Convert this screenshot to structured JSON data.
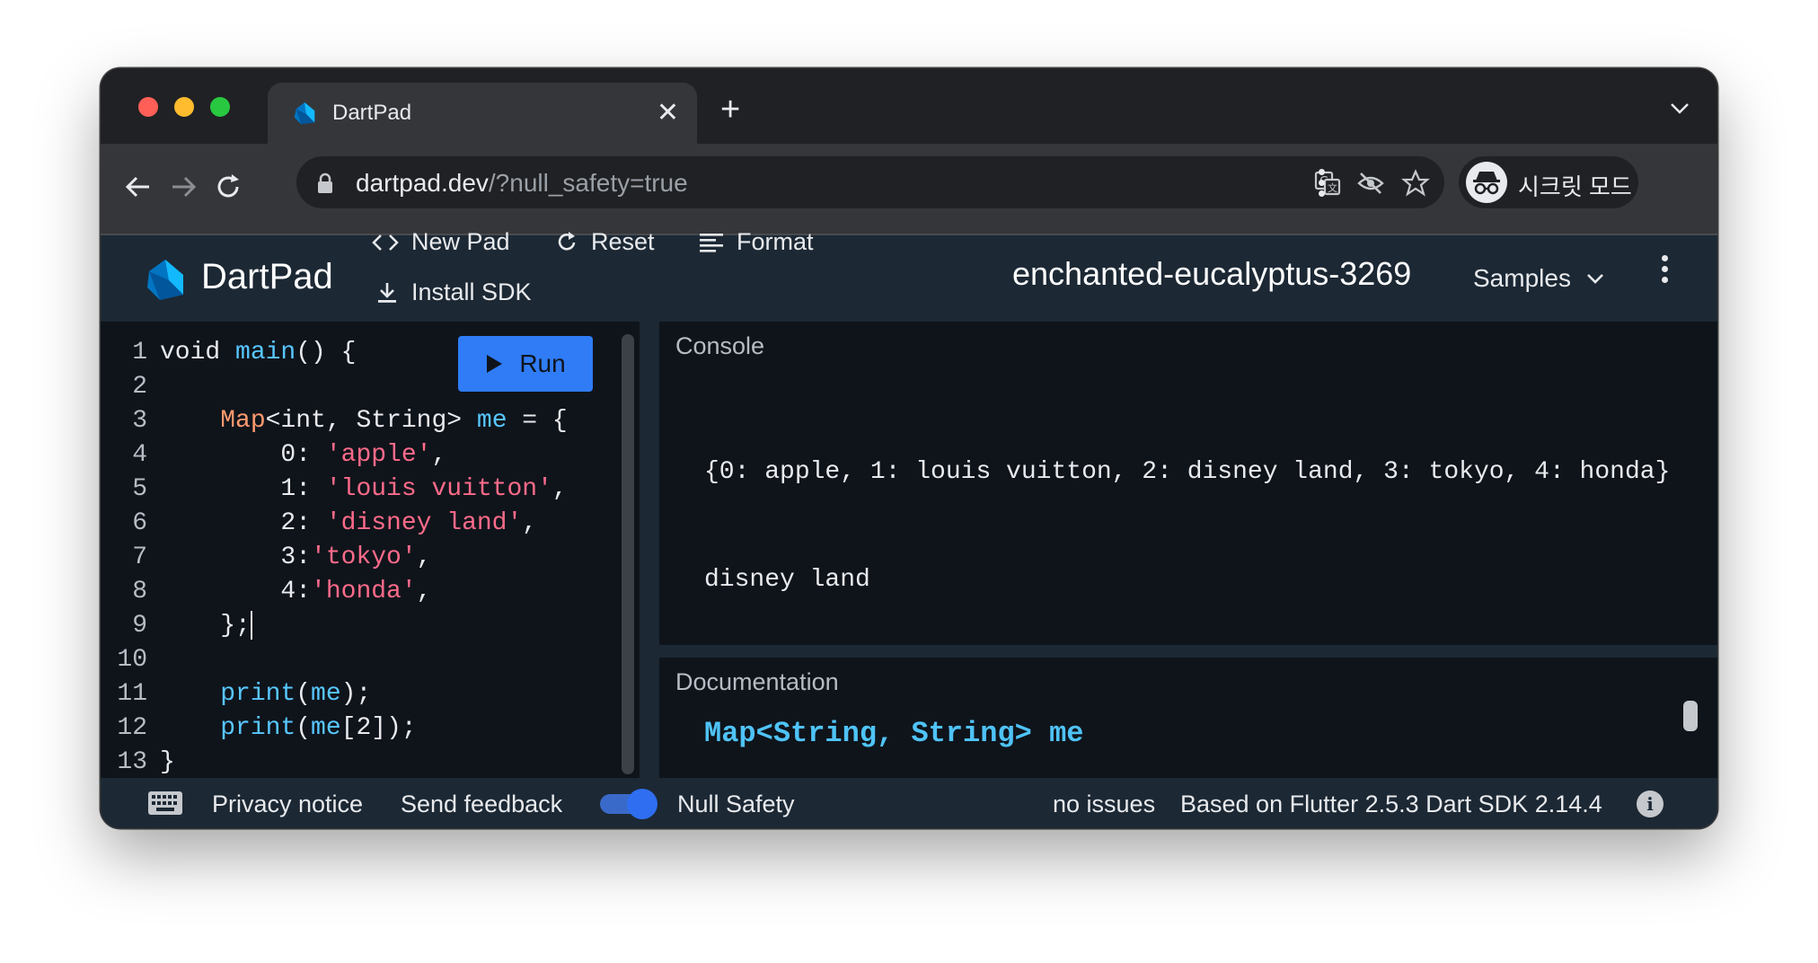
{
  "browser": {
    "tab_title": "DartPad",
    "tab_close": "✕",
    "new_tab": "+",
    "url_host": "dartpad.dev",
    "url_path": "/?null_safety=true",
    "profile_name": "시크릿 모드"
  },
  "header": {
    "app_title": "DartPad",
    "new_pad": "New Pad",
    "reset": "Reset",
    "format": "Format",
    "install_sdk": "Install SDK",
    "pad_name": "enchanted-eucalyptus-3269",
    "samples": "Samples"
  },
  "editor": {
    "run_label": "Run",
    "line_numbers": [
      "1",
      "2",
      "3",
      "4",
      "5",
      "6",
      "7",
      "8",
      "9",
      "10",
      "11",
      "12",
      "13"
    ]
  },
  "console": {
    "title": "Console",
    "output_lines": [
      "{0: apple, 1: louis vuitton, 2: disney land, 3: tokyo, 4: honda}",
      "disney land"
    ]
  },
  "documentation": {
    "title": "Documentation",
    "signature": "Map<String, String> me"
  },
  "footer": {
    "privacy": "Privacy notice",
    "feedback": "Send feedback",
    "null_safety": "Null Safety",
    "issues": "no issues",
    "version": "Based on Flutter 2.5.3 Dart SDK 2.14.4",
    "info": "i"
  },
  "colors": {
    "accent": "#2f7cf6",
    "header_bg": "#1c2834",
    "editor_bg": "#0f141b",
    "string": "#ff6b8a",
    "function": "#58c7ff",
    "type": "#ff9a6e"
  }
}
